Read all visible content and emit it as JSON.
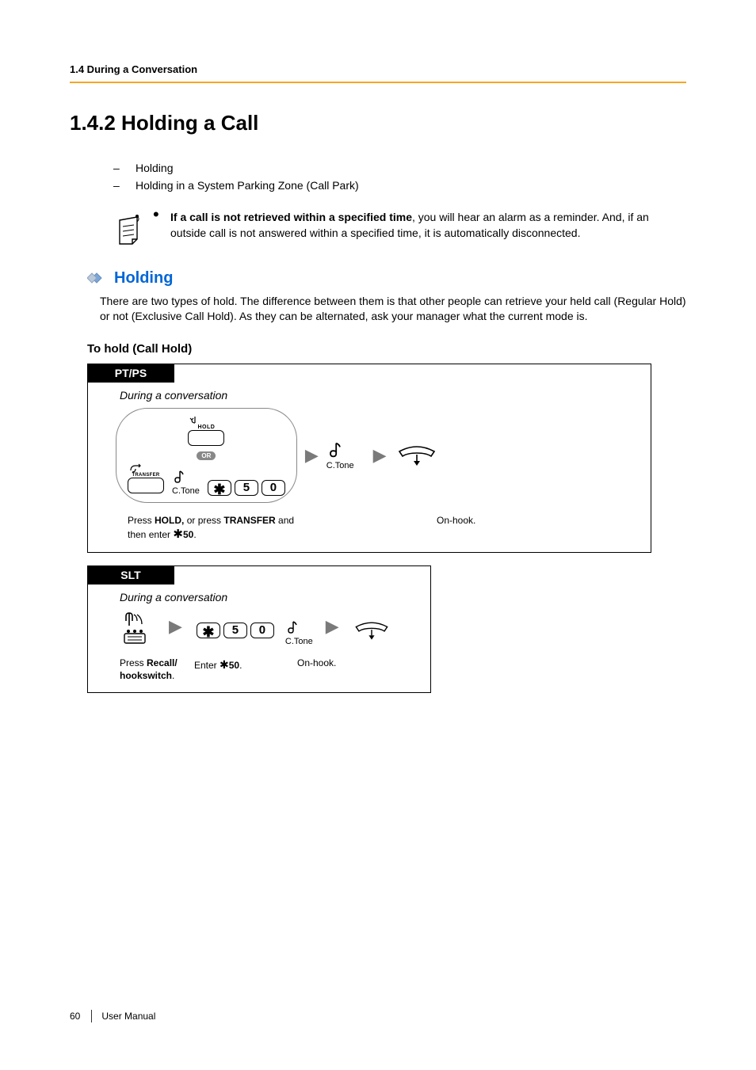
{
  "header": {
    "section": "1.4 During a Conversation"
  },
  "title": "1.4.2    Holding a Call",
  "bullets": {
    "item1": "Holding",
    "item2": "Holding in a System Parking Zone (Call Park)"
  },
  "note": {
    "bold": "If a call is not retrieved within a specified time",
    "rest": ", you will hear an alarm as a reminder. And, if an outside call is not answered within a specified time, it is automatically disconnected."
  },
  "holding": {
    "title": "Holding",
    "para": "There are two types of hold. The difference between them is that other people can retrieve your held call (Regular Hold) or not (Exclusive Call Hold). As they can be alternated, ask your manager what the current mode is."
  },
  "boldLabel": "To hold (Call Hold)",
  "ptps": {
    "tab": "PT/PS",
    "during": "During a conversation",
    "hold": "HOLD",
    "or": "OR",
    "transfer": "TRANSFER",
    "ctone": "C.Tone",
    "key_star": "✱",
    "key_5": "5",
    "key_0": "0",
    "instruction1a": "Press ",
    "instruction1b": "HOLD,",
    "instruction1c": " or press ",
    "instruction1d": "TRANSFER",
    "instruction1e": " and then enter ",
    "instruction1f": "50",
    "instruction1g": ".",
    "onhook": "On-hook."
  },
  "slt": {
    "tab": "SLT",
    "during": "During a conversation",
    "ctone": "C.Tone",
    "key_star": "✱",
    "key_5": "5",
    "key_0": "0",
    "instr1a": "Press ",
    "instr1b": "Recall/ hookswitch",
    "instr1c": ".",
    "instr2a": "Enter ",
    "instr2b": "50",
    "instr2c": ".",
    "onhook": "On-hook."
  },
  "footer": {
    "page": "60",
    "manual": "User Manual"
  }
}
